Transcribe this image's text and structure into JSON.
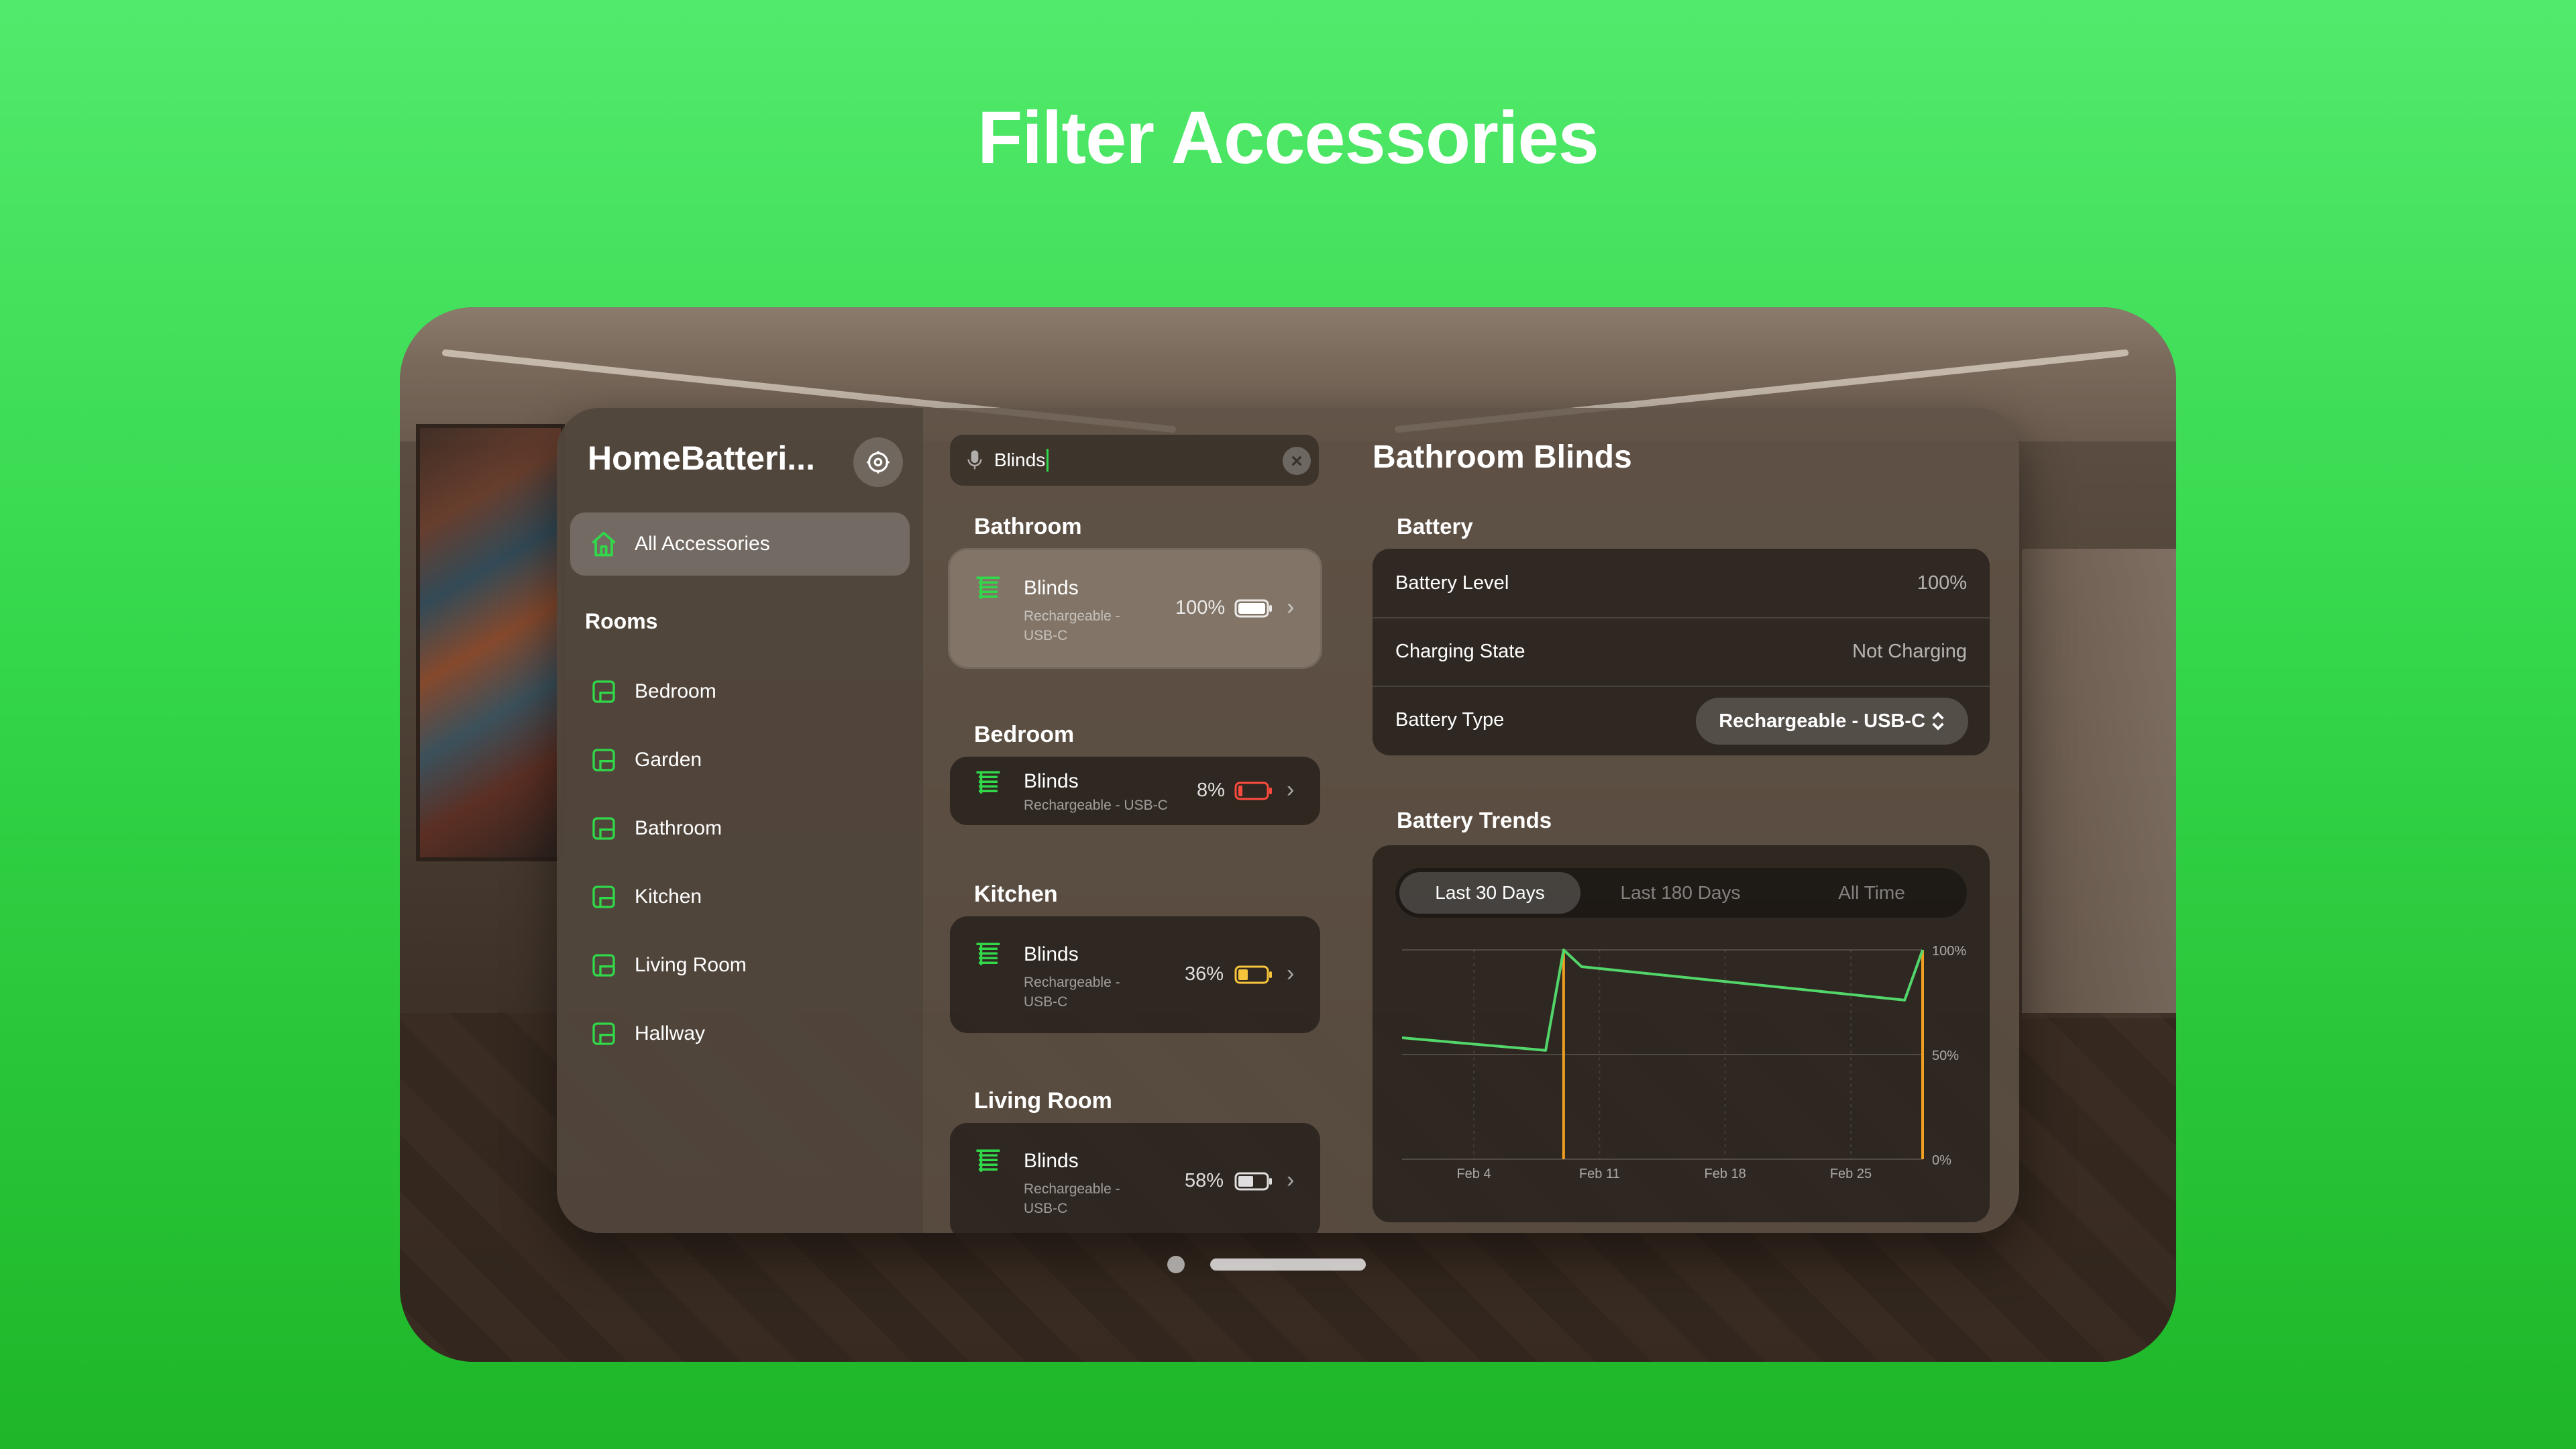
{
  "headline": "Filter Accessories",
  "colors": {
    "accent": "#31d84a",
    "background_top": "#52ea6c",
    "background_bottom": "#1fb629",
    "chart_line": "#52d66a",
    "chart_event": "#f0a020",
    "battery_low": "#ff4b3e",
    "battery_mid": "#f5c43a"
  },
  "sidebar": {
    "app_title": "HomeBatteri...",
    "settings_icon": "gear-icon",
    "all_accessories": {
      "label": "All Accessories",
      "icon": "house-icon"
    },
    "rooms_heading": "Rooms",
    "rooms": [
      {
        "label": "Bedroom",
        "icon": "room-icon"
      },
      {
        "label": "Garden",
        "icon": "room-icon"
      },
      {
        "label": "Bathroom",
        "icon": "room-icon"
      },
      {
        "label": "Kitchen",
        "icon": "room-icon"
      },
      {
        "label": "Living Room",
        "icon": "room-icon"
      },
      {
        "label": "Hallway",
        "icon": "room-icon"
      }
    ]
  },
  "search": {
    "value": "Blinds",
    "mic_icon": "mic-icon",
    "clear_icon": "close-icon"
  },
  "results": [
    {
      "section": "Bathroom",
      "name": "Blinds",
      "type": "Rechargeable - USB-C",
      "percent": "100%",
      "level": 1.0,
      "selected": true
    },
    {
      "section": "Bedroom",
      "name": "Blinds",
      "type": "Rechargeable - USB-C",
      "percent": "8%",
      "level": 0.08,
      "selected": false
    },
    {
      "section": "Kitchen",
      "name": "Blinds",
      "type": "Rechargeable - USB-C",
      "percent": "36%",
      "level": 0.36,
      "selected": false
    },
    {
      "section": "Living Room",
      "name": "Blinds",
      "type": "Rechargeable - USB-C",
      "percent": "58%",
      "level": 0.58,
      "selected": false
    }
  ],
  "detail": {
    "title": "Bathroom Blinds",
    "battery_heading": "Battery",
    "battery_level_label": "Battery Level",
    "battery_level_value": "100%",
    "charging_state_label": "Charging State",
    "charging_state_value": "Not Charging",
    "battery_type_label": "Battery Type",
    "battery_type_value": "Rechargeable - USB-C",
    "trends_heading": "Battery Trends",
    "ranges": [
      "Last 30 Days",
      "Last 180 Days",
      "All Time"
    ],
    "active_range": "Last 30 Days"
  },
  "chart_data": {
    "type": "line",
    "x_ticks": [
      "Feb 4",
      "Feb 11",
      "Feb 18",
      "Feb 25"
    ],
    "y_ticks": [
      "100%",
      "50%",
      "0%"
    ],
    "ylim": [
      0,
      100
    ],
    "xlim": [
      "Jan 31",
      "Mar 1"
    ],
    "series": [
      {
        "points": [
          [
            "Jan 31",
            58
          ],
          [
            "Feb 8",
            52
          ],
          [
            "Feb 9",
            100
          ],
          [
            "Feb 10",
            92
          ],
          [
            "Feb 28",
            76
          ],
          [
            "Mar 1",
            100
          ]
        ]
      }
    ],
    "charge_events": [
      "Feb 9",
      "Mar 1"
    ],
    "grid": true
  }
}
